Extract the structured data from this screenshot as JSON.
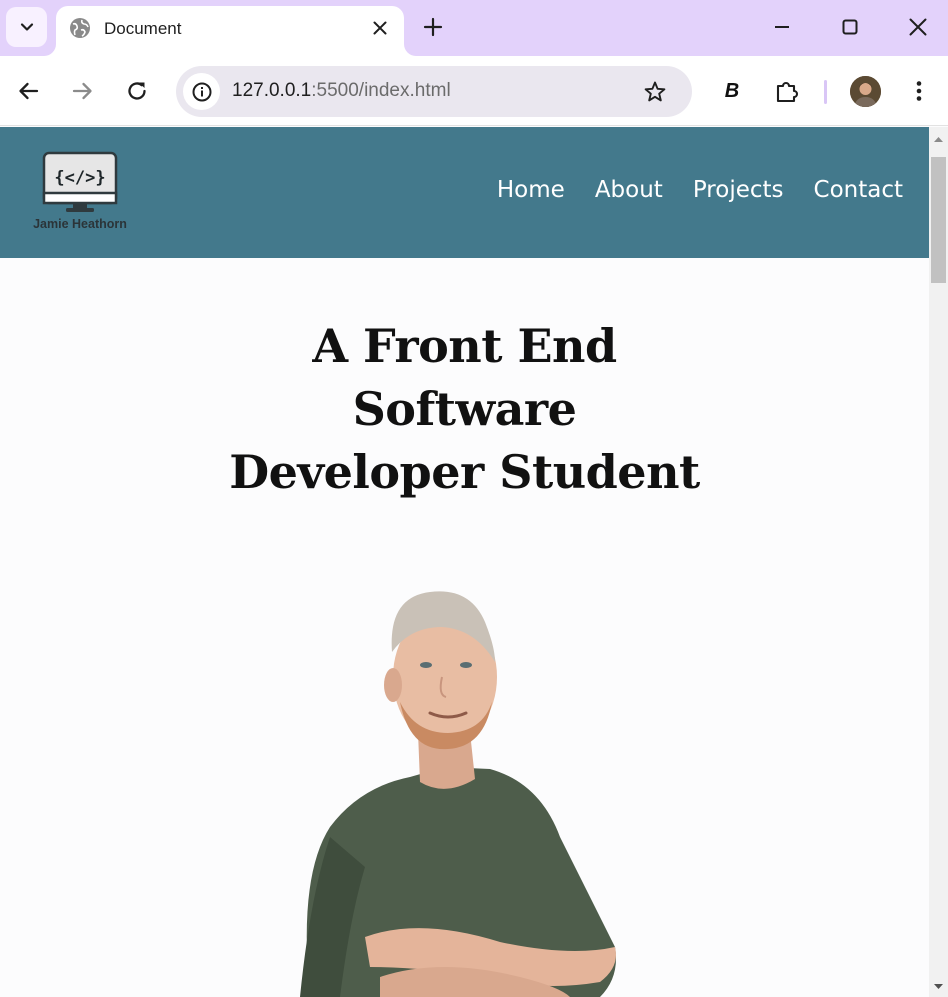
{
  "browser": {
    "tab": {
      "title": "Document"
    },
    "url": {
      "host": "127.0.0.1",
      "rest": ":5500/index.html"
    },
    "extension_label": "B"
  },
  "site": {
    "logo": {
      "code": "{</>}",
      "name": "Jamie Heathorn"
    },
    "nav": [
      "Home",
      "About",
      "Projects",
      "Contact"
    ],
    "hero": {
      "lines": [
        "A Front End",
        "Software",
        "Developer Student"
      ]
    }
  },
  "colors": {
    "tabstrip": "#e3d2fb",
    "header": "#43798c",
    "page_bg": "#fcfcfd",
    "shirt": "#4e5d4b"
  }
}
